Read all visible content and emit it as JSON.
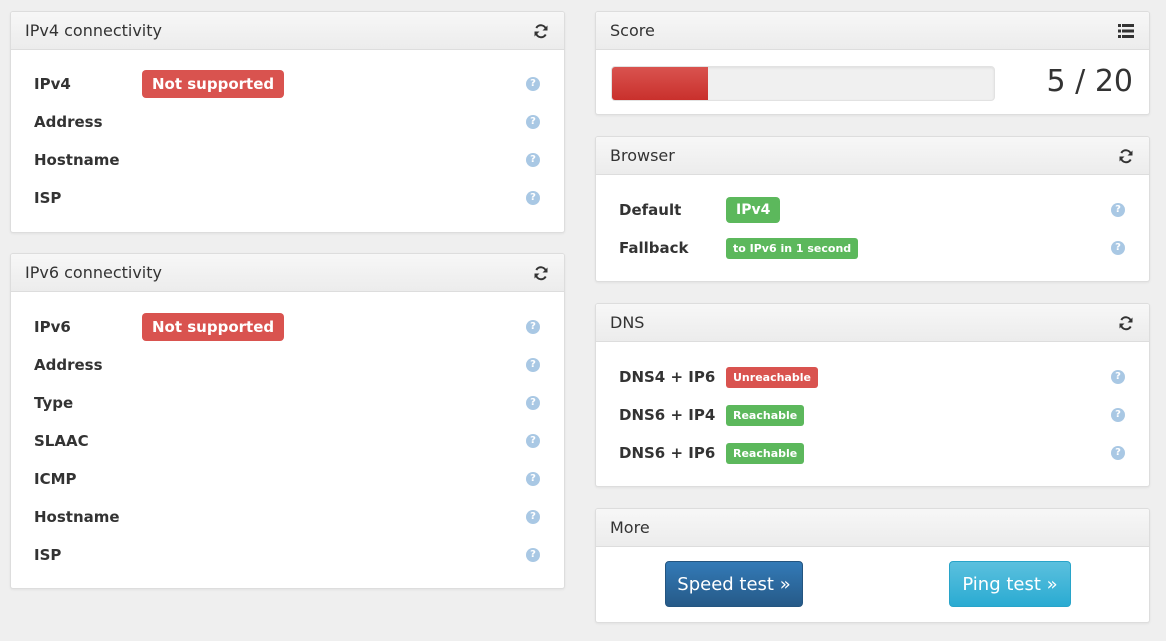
{
  "ipv4": {
    "title": "IPv4 connectivity",
    "rows": [
      {
        "label": "IPv4",
        "badge": "Not supported"
      },
      {
        "label": "Address"
      },
      {
        "label": "Hostname"
      },
      {
        "label": "ISP"
      }
    ]
  },
  "ipv6": {
    "title": "IPv6 connectivity",
    "rows": [
      {
        "label": "IPv6",
        "badge": "Not supported"
      },
      {
        "label": "Address"
      },
      {
        "label": "Type"
      },
      {
        "label": "SLAAC"
      },
      {
        "label": "ICMP"
      },
      {
        "label": "Hostname"
      },
      {
        "label": "ISP"
      }
    ]
  },
  "score": {
    "title": "Score",
    "text": "5 / 20",
    "value": 5,
    "max": 20
  },
  "browser": {
    "title": "Browser",
    "rows": [
      {
        "label": "Default",
        "badge": "IPv4"
      },
      {
        "label": "Fallback",
        "badge": "to IPv6 in 1 second"
      }
    ]
  },
  "dns": {
    "title": "DNS",
    "rows": [
      {
        "label": "DNS4 + IP6",
        "badge": "Unreachable"
      },
      {
        "label": "DNS6 + IP4",
        "badge": "Reachable"
      },
      {
        "label": "DNS6 + IP6",
        "badge": "Reachable"
      }
    ]
  },
  "more": {
    "title": "More",
    "speed_label": "Speed test »",
    "ping_label": "Ping test »"
  },
  "icons": {
    "refresh": "refresh-icon",
    "list": "list-icon",
    "help": "question-circle-icon"
  },
  "colors": {
    "danger": "#d9534f",
    "success": "#5cb85c",
    "primary": "#337ab7",
    "info": "#5bc0de",
    "help": "#a9c8e4"
  }
}
